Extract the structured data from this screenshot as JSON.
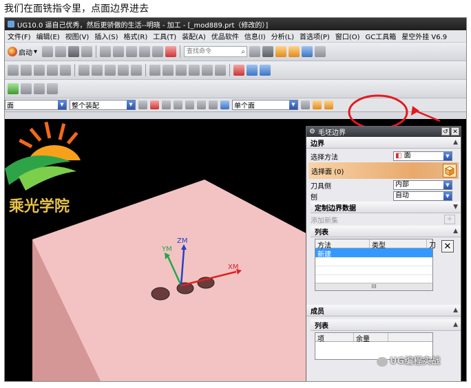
{
  "caption": "我们在面铣指令里，点面边界进去",
  "window": {
    "title": "UG10.0 逼自己优秀，然后更骄傲的生活--明晓 - 加工 - [_mod889.prt（修改的）]"
  },
  "menubar": {
    "items": [
      "文件(F)",
      "编辑(E)",
      "视图(V)",
      "插入(S)",
      "格式(R)",
      "工具(T)",
      "装配(A)",
      "优品软件",
      "信息(I)",
      "分析(L)",
      "首选项(P)",
      "窗口(O)",
      "GC工具箱",
      "星空外挂 V6.9"
    ]
  },
  "toolbar": {
    "start_label": "启动",
    "search_placeholder": "查找命令"
  },
  "selection_bar": {
    "filter_value": "面",
    "scope_value": "整个装配",
    "face_rule_value": "单个面"
  },
  "viewport": {
    "logo_text": "乘光学院",
    "axis_x": "XM",
    "axis_y": "YM",
    "axis_z": "ZM",
    "watermark": "UG编程实战",
    "colors": {
      "part_top": "#f6c7c7",
      "part_side": "#d79a9a",
      "background": "#000000",
      "highlight_circle": "#e5191e"
    }
  },
  "dialog": {
    "title": "毛坯边界",
    "boundary_section": "边界",
    "select_method_label": "选择方法",
    "select_method_value": "面",
    "select_face_label": "选择面 (0)",
    "tool_side_label": "刀具侧",
    "tool_side_value": "内部",
    "plane_label": "刨",
    "plane_value": "自动",
    "custom_boundary_label": "定制边界数据",
    "add_set_label": "添加新集",
    "list_label": "列表",
    "list_columns": [
      "方法",
      "类型",
      "刀"
    ],
    "list_rows": [
      [
        "新建",
        ""
      ]
    ],
    "members_section": "成员",
    "members_list_label": "列表",
    "members_columns": [
      "项",
      "余量"
    ]
  }
}
